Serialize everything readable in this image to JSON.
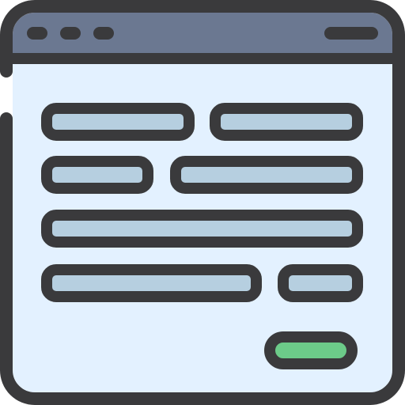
{
  "window": {
    "controls": [
      "dot-1",
      "dot-2",
      "dot-3"
    ],
    "fields_rows": [
      [
        "field",
        "field"
      ],
      [
        "field",
        "field"
      ],
      [
        "field"
      ],
      [
        "field",
        "field"
      ]
    ],
    "submit_button": {
      "label": ""
    }
  },
  "colors": {
    "outline": "#3a3a3c",
    "titlebar": "#6b7891",
    "content_bg": "#e3f1ff",
    "field_fill": "#b6cfe0",
    "button_fill": "#6ccb89",
    "page_bg": "#ffffff"
  },
  "icons": {
    "window": "browser-window-icon",
    "form": "form-icon"
  }
}
